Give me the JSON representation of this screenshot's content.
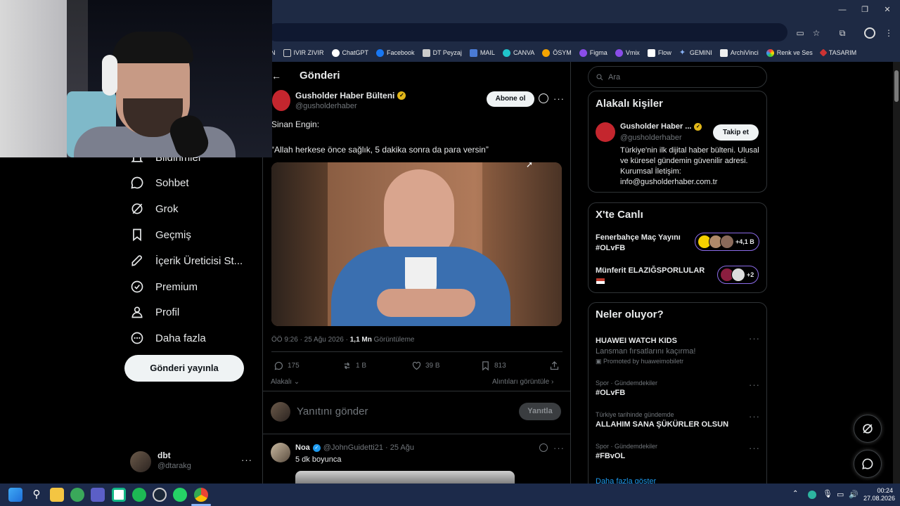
{
  "bookmarks": [
    {
      "label": "N",
      "icon": "folder-icon"
    },
    {
      "label": "IVIR ZIVIR",
      "icon": "folder-icon"
    },
    {
      "label": "ChatGPT",
      "icon": "chatgpt-icon"
    },
    {
      "label": "Facebook",
      "icon": "facebook-icon"
    },
    {
      "label": "DT Peyzaj",
      "icon": "page-icon"
    },
    {
      "label": "MAIL",
      "icon": "mail-icon"
    },
    {
      "label": "CANVA",
      "icon": "canva-icon"
    },
    {
      "label": "ÖSYM",
      "icon": "osym-icon"
    },
    {
      "label": "Figma",
      "icon": "figma-icon"
    },
    {
      "label": "Vmix",
      "icon": "vmix-icon"
    },
    {
      "label": "Flow",
      "icon": "flow-icon"
    },
    {
      "label": "GEMINI",
      "icon": "gemini-icon"
    },
    {
      "label": "ArchiVinci",
      "icon": "archivinci-icon"
    },
    {
      "label": "Renk ve Ses",
      "icon": "renk-icon"
    },
    {
      "label": "TASARIM",
      "icon": "tasarim-icon"
    }
  ],
  "nav": {
    "items": [
      {
        "label": "Bildirimler",
        "icon": "bell-icon"
      },
      {
        "label": "Sohbet",
        "icon": "chat-icon"
      },
      {
        "label": "Grok",
        "icon": "grok-icon"
      },
      {
        "label": "Geçmiş",
        "icon": "bookmark-icon"
      },
      {
        "label": "İçerik Üreticisi St...",
        "icon": "rocket-icon"
      },
      {
        "label": "Premium",
        "icon": "verified-icon"
      },
      {
        "label": "Profil",
        "icon": "person-icon"
      },
      {
        "label": "Daha fazla",
        "icon": "more-circle-icon"
      }
    ],
    "post_button": "Gönderi yayınla",
    "account": {
      "name": "dbt",
      "handle": "@dtarakg"
    }
  },
  "post": {
    "header_title": "Gönderi",
    "author_name": "Gusholder Haber Bülteni",
    "author_handle": "@gusholderhaber",
    "subscribe_label": "Abone ol",
    "line1": "Sinan Engin:",
    "line2": "“Allah herkese önce sağlık, 5 dakika sonra da para versin”",
    "time": "ÖÖ 9:26 · 25 Ağu 2026 · ",
    "views_count": "1,1 Mn",
    "views_label": " Görüntüleme",
    "replies": "175",
    "reposts": "1 B",
    "likes": "39 B",
    "bookmarks": "813",
    "sort_label": "Alakalı",
    "quotes_label": "Alıntıları görüntüle",
    "reply_placeholder": "Yanıtını gönder",
    "reply_button": "Yanıtla"
  },
  "reply": {
    "name": "Noa",
    "handle": "@JohnGuidetti21 · 25 Ağu",
    "text": "5 dk boyunca"
  },
  "sidebar": {
    "search_placeholder": "Ara",
    "related_title": "Alakalı kişiler",
    "related_name": "Gusholder Haber ...",
    "related_handle": "@gusholderhaber",
    "follow_label": "Takip et",
    "related_bio": "Türkiye'nin ilk dijital haber bülteni. Ulusal ve küresel gündemin güvenilir adresi. Kurumsal İletişim: info@gusholderhaber.com.tr",
    "live_title": "X'te Canlı",
    "live": [
      {
        "title": "Fenerbahçe Maç Yayını #OLvFB",
        "count": "+4,1 B"
      },
      {
        "title": "Münferit ELAZIĞSPORLULAR",
        "count": "+2"
      }
    ],
    "trends_title": "Neler oluyor?",
    "trends": [
      {
        "context": "",
        "title": "HUAWEI WATCH KIDS",
        "sub": "Lansman fırsatlarını kaçırma!",
        "promo": "Promoted by huaweimobiletr"
      },
      {
        "context": "Spor · Gündemdekiler",
        "title": "#OLvFB"
      },
      {
        "context": "Türkiye tarihinde gündemde",
        "title": "ALLAHIM SANA ŞÜKÜRLER OLSUN"
      },
      {
        "context": "Spor · Gündemdekiler",
        "title": "#FBvOL"
      }
    ],
    "show_more": "Daha fazla göster"
  },
  "taskbar": {
    "time": "00:24",
    "date": "27.08.2026"
  },
  "colors": {
    "accent": "#1d9bf0",
    "verified_gold": "#e2b719",
    "live_border": "#8b6be8"
  }
}
